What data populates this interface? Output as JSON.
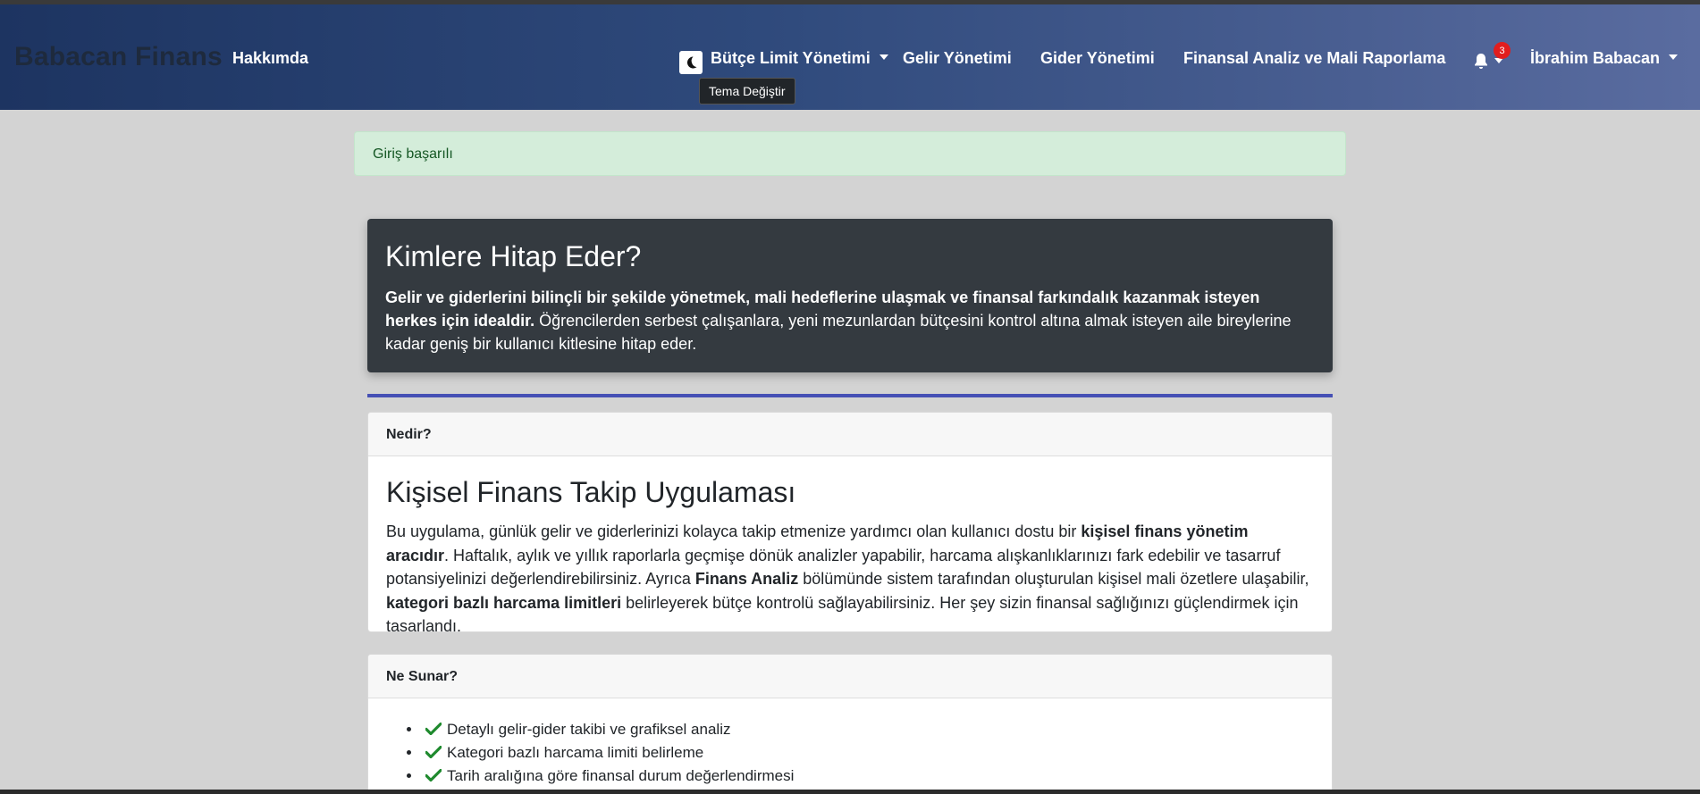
{
  "navbar": {
    "brand": "Babacan Finans",
    "about": "Hakkımda",
    "budget": "Bütçe Limit Yönetimi",
    "income": "Gelir Yönetimi",
    "expense": "Gider Yönetimi",
    "analysis": "Finansal Analiz ve Mali Raporlama",
    "notification_count": "3",
    "user": "İbrahim Babacan",
    "theme_tooltip": "Tema Değiştir"
  },
  "alert": {
    "text": "Giriş başarılı"
  },
  "audience": {
    "title": "Kimlere Hitap Eder?",
    "bold_text": "Gelir ve giderlerini bilinçli bir şekilde yönetmek, mali hedeflerine ulaşmak ve finansal farkındalık kazanmak isteyen herkes için idealdir.",
    "text": " Öğrencilerden serbest çalışanlara, yeni mezunlardan bütçesini kontrol altına almak isteyen aile bireylerine kadar geniş bir kullanıcı kitlesine hitap eder."
  },
  "what": {
    "header": "Nedir?",
    "title": "Kişisel Finans Takip Uygulaması",
    "p1": "Bu uygulama, günlük gelir ve giderlerinizi kolayca takip etmenize yardımcı olan kullanıcı dostu bir ",
    "b1": "kişisel finans yönetim aracıdır",
    "p2": ". Haftalık, aylık ve yıllık raporlarla geçmişe dönük analizler yapabilir, harcama alışkanlıklarınızı fark edebilir ve tasarruf potansiyelinizi değerlendirebilirsiniz. Ayrıca ",
    "b2": "Finans Analiz",
    "p3": " bölümünde sistem tarafından oluşturulan kişisel mali özetlere ulaşabilir, ",
    "b3": "kategori bazlı harcama limitleri",
    "p4": " belirleyerek bütçe kontrolü sağlayabilirsiniz. Her şey sizin finansal sağlığınızı güçlendirmek için tasarlandı."
  },
  "offers": {
    "header": "Ne Sunar?",
    "items": [
      "Detaylı gelir-gider takibi ve grafiksel analiz",
      "Kategori bazlı harcama limiti belirleme",
      "Tarih aralığına göre finansal durum değerlendirmesi"
    ]
  },
  "colors": {
    "accent_divider": "#4650b5",
    "check_green": "#1f8a2e",
    "badge_red": "#e11d1d"
  }
}
